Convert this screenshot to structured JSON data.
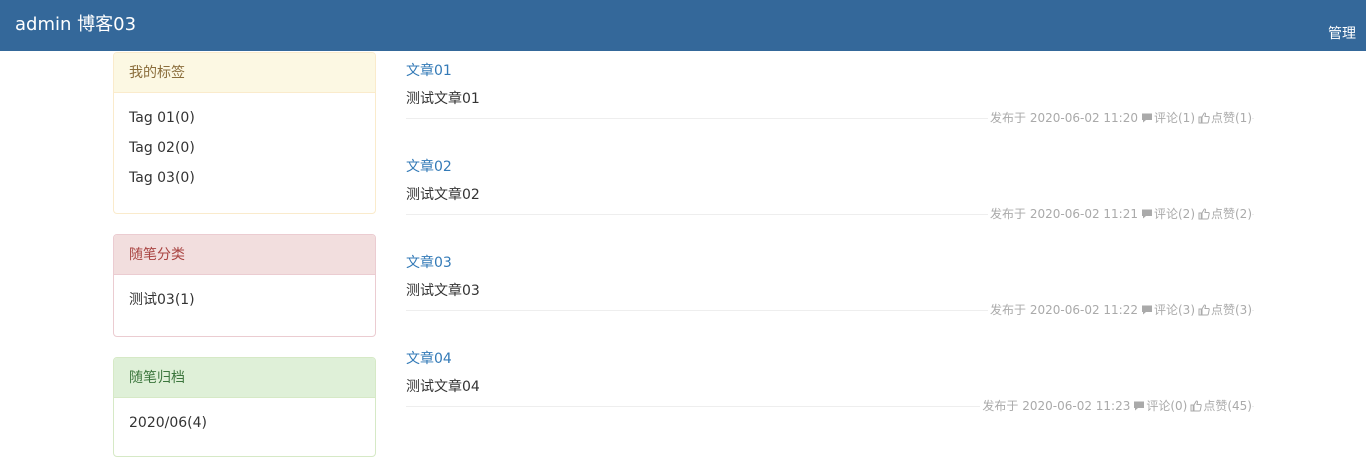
{
  "header": {
    "brand": "admin 博客03",
    "manage": "管理"
  },
  "sidebar": {
    "tags": {
      "title": "我的标签",
      "items": [
        "Tag 01(0)",
        "Tag 02(0)",
        "Tag 03(0)"
      ]
    },
    "categories": {
      "title": "随笔分类",
      "items": [
        "测试03(1)"
      ]
    },
    "archive": {
      "title": "随笔归档",
      "items": [
        "2020/06(4)"
      ]
    }
  },
  "articles": [
    {
      "title": "文章01",
      "body": "测试文章01",
      "published": "发布于 2020-06-02 11:20",
      "comments": "评论(1)",
      "likes": "点赞(1)"
    },
    {
      "title": "文章02",
      "body": "测试文章02",
      "published": "发布于 2020-06-02 11:21",
      "comments": "评论(2)",
      "likes": "点赞(2)"
    },
    {
      "title": "文章03",
      "body": "测试文章03",
      "published": "发布于 2020-06-02 11:22",
      "comments": "评论(3)",
      "likes": "点赞(3)"
    },
    {
      "title": "文章04",
      "body": "测试文章04",
      "published": "发布于 2020-06-02 11:23",
      "comments": "评论(0)",
      "likes": "点赞(45)"
    }
  ]
}
